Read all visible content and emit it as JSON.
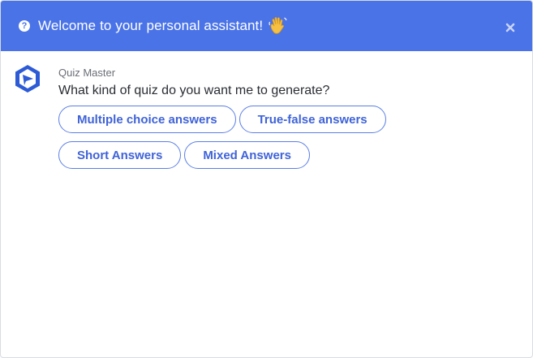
{
  "header": {
    "title": "Welcome to your personal assistant!",
    "help_icon": "question-circle-icon",
    "wave_icon": "waving-hand-icon",
    "close_icon": "close-icon",
    "background_color": "#4a73e8"
  },
  "message": {
    "sender": "Quiz Master",
    "avatar_icon": "quiz-master-logo-icon",
    "text": "What kind of quiz do you want me to generate?"
  },
  "options": [
    {
      "label": "Multiple choice answers"
    },
    {
      "label": "True-false answers"
    },
    {
      "label": "Short Answers"
    },
    {
      "label": "Mixed Answers"
    }
  ],
  "colors": {
    "accent": "#4a73e8",
    "button_text": "#3f63d8"
  }
}
